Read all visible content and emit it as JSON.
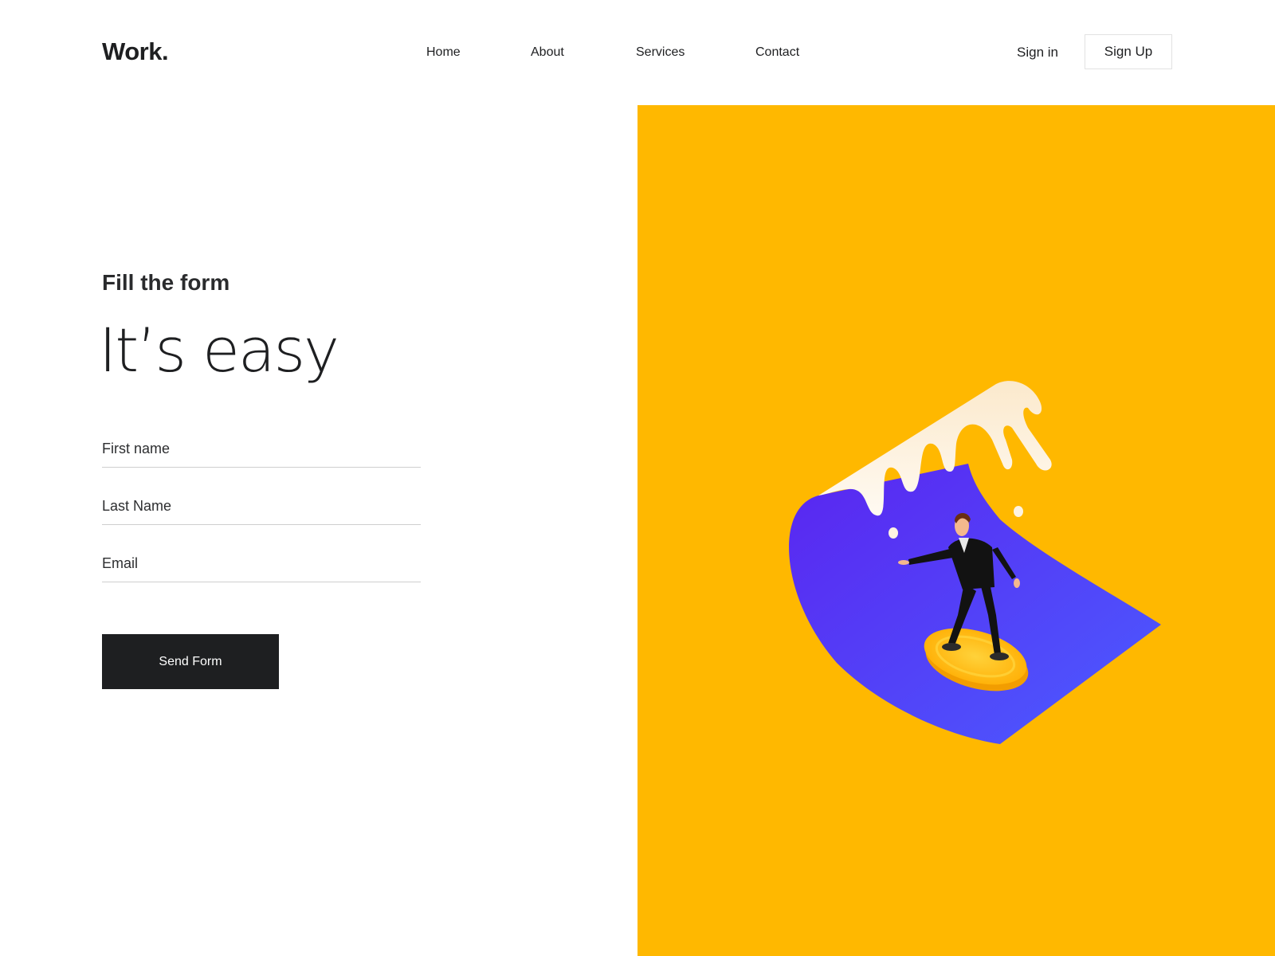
{
  "header": {
    "logo": "Work.",
    "nav": [
      {
        "label": "Home"
      },
      {
        "label": "About"
      },
      {
        "label": "Services"
      },
      {
        "label": "Contact"
      }
    ],
    "sign_in": "Sign in",
    "sign_up": "Sign Up"
  },
  "form": {
    "eyebrow": "Fill the form",
    "headline": "It’s easy",
    "fields": {
      "first_name": {
        "placeholder": "First name",
        "value": ""
      },
      "last_name": {
        "placeholder": "Last Name",
        "value": ""
      },
      "email": {
        "placeholder": "Email",
        "value": ""
      }
    },
    "submit": "Send Form"
  },
  "illustration": {
    "name": "man-surfing-coin-wave",
    "colors": {
      "background": "#ffb800",
      "wave": "#4f3cf2",
      "foam": "#fdf3e2",
      "coin": "#ffc21a"
    }
  },
  "theme": {
    "text": "#1e1f21",
    "button_bg": "#1e1f21",
    "button_text": "#ffffff",
    "accent": "#ffb800"
  }
}
